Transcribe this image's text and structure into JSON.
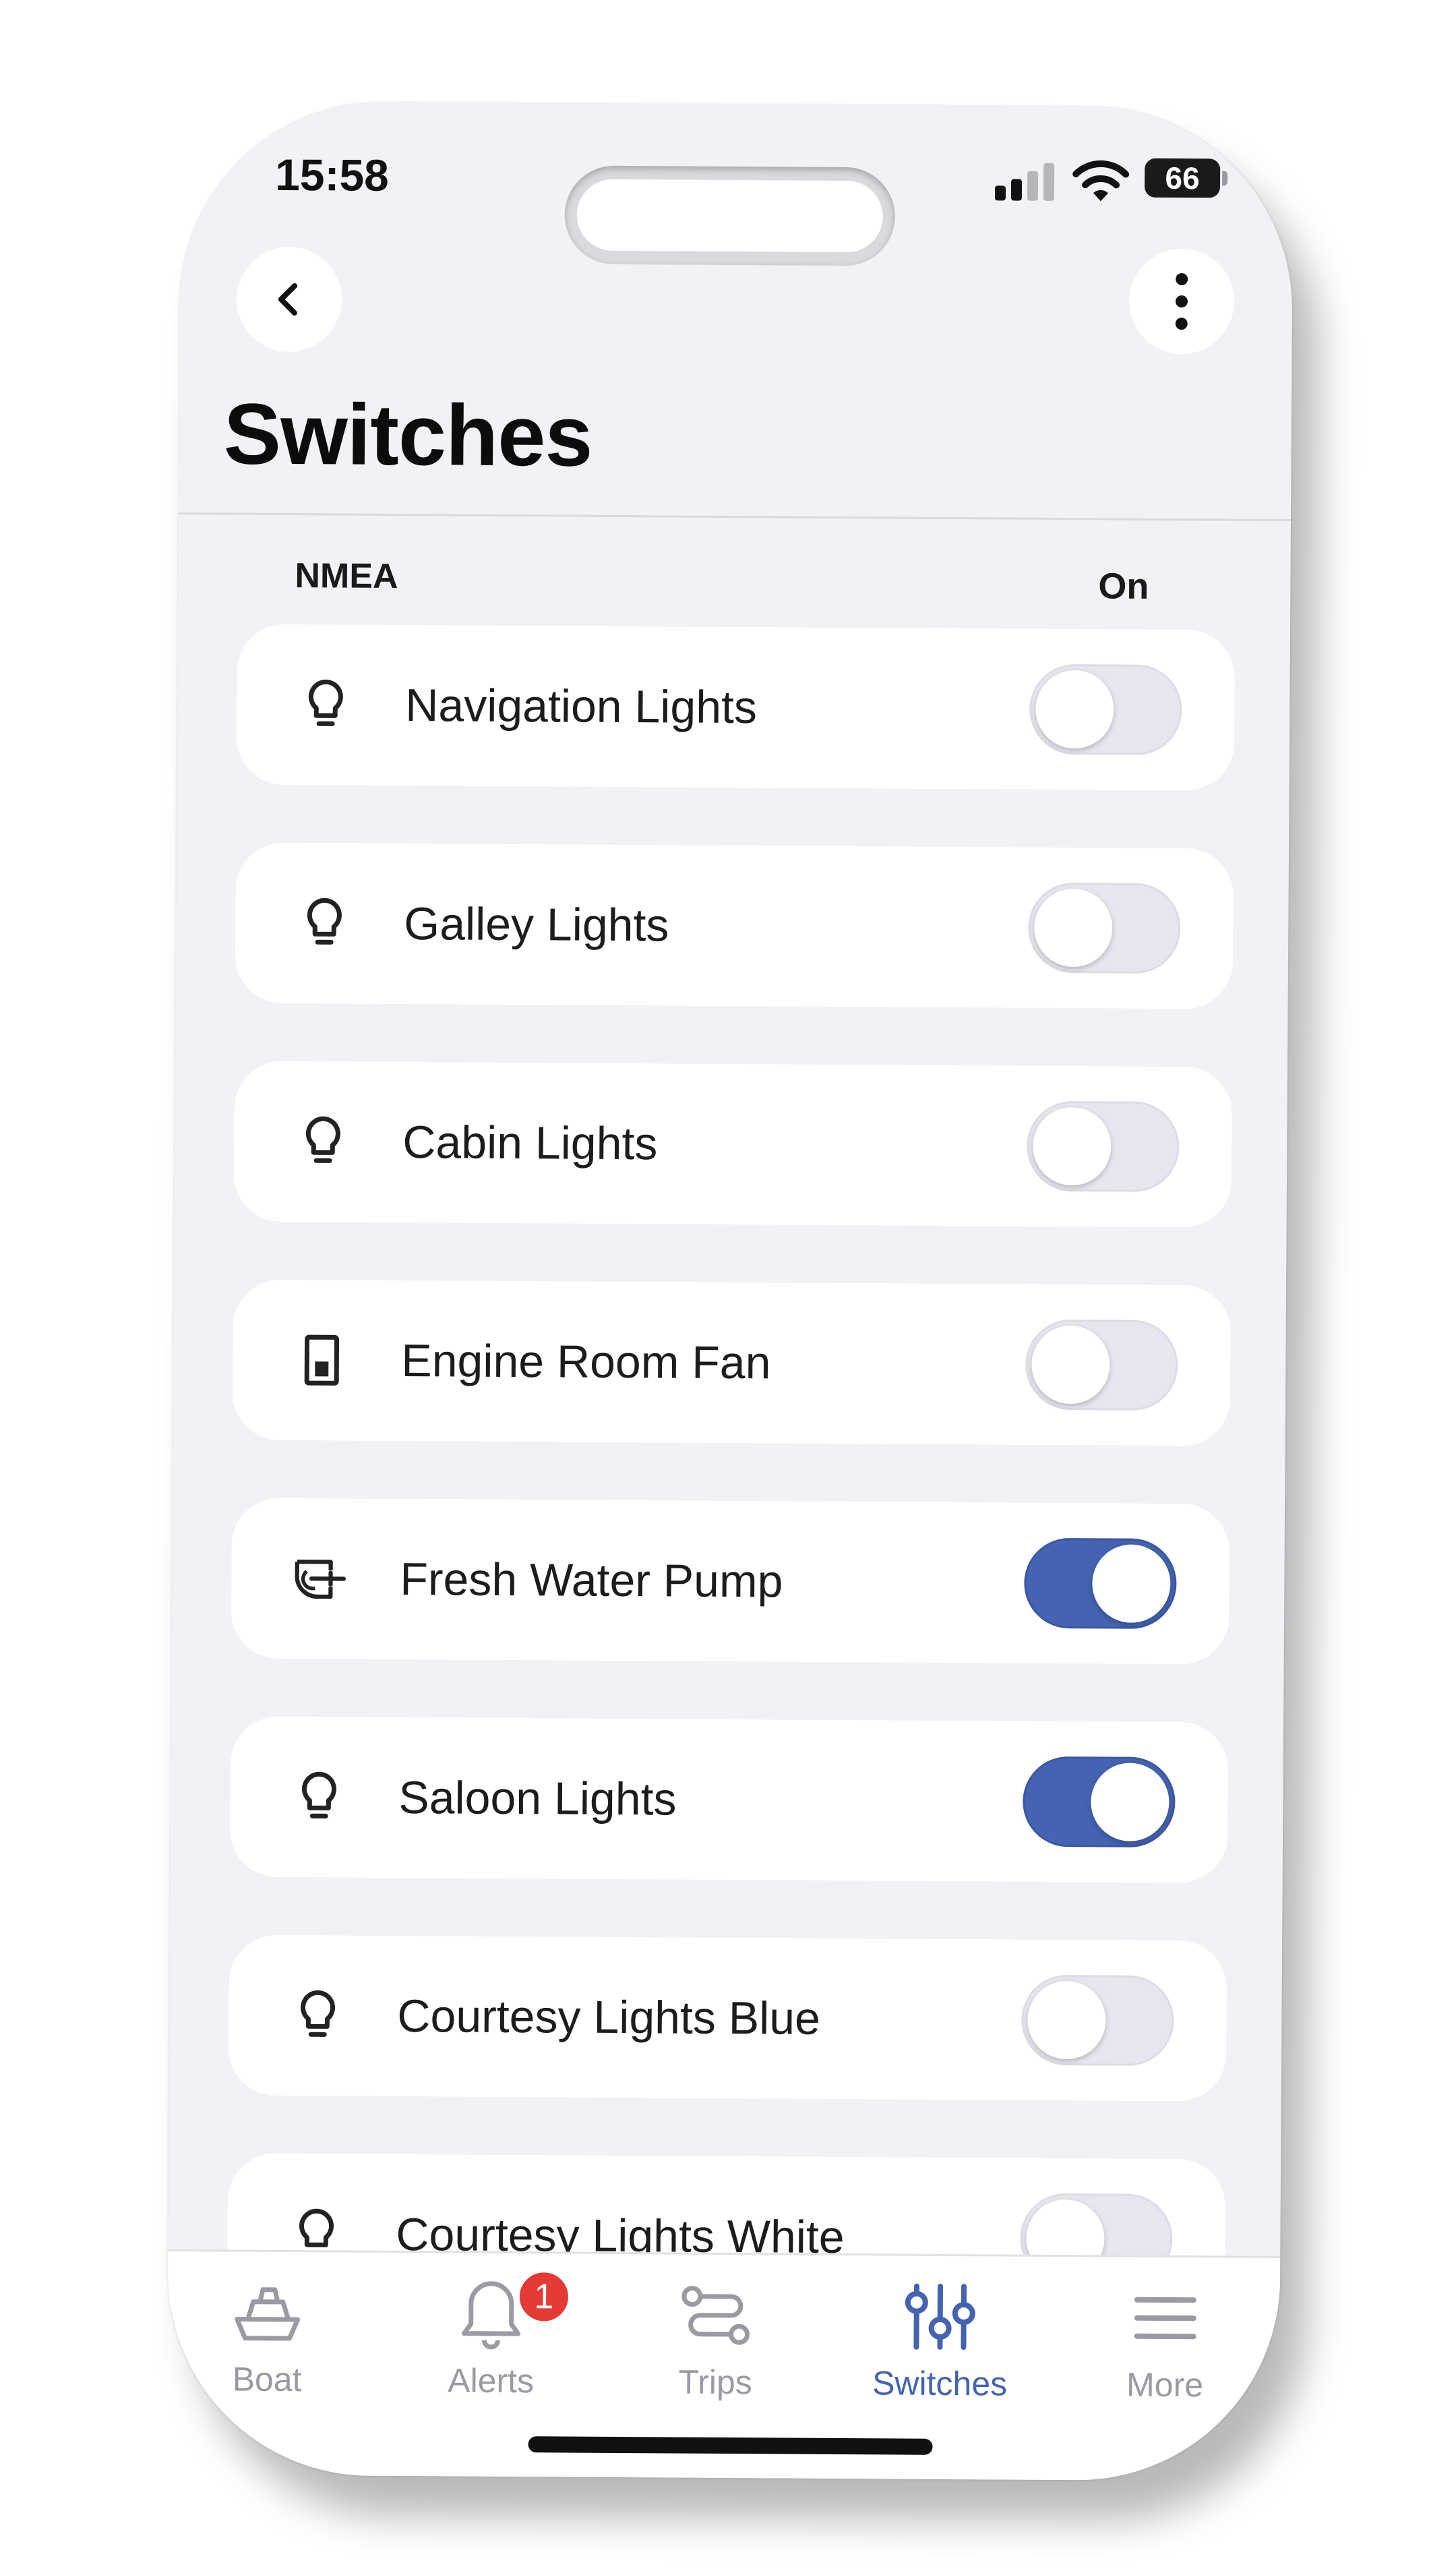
{
  "status_bar": {
    "time": "15:58",
    "battery": "66"
  },
  "header": {
    "title": "Switches"
  },
  "section": {
    "label": "NMEA",
    "column_on": "On"
  },
  "switches": [
    {
      "label": "Navigation Lights",
      "icon": "bulb-icon",
      "on": false
    },
    {
      "label": "Galley Lights",
      "icon": "bulb-icon",
      "on": false
    },
    {
      "label": "Cabin Lights",
      "icon": "bulb-icon",
      "on": false
    },
    {
      "label": "Engine Room Fan",
      "icon": "switch-icon",
      "on": false
    },
    {
      "label": "Fresh Water Pump",
      "icon": "pump-icon",
      "on": true
    },
    {
      "label": "Saloon Lights",
      "icon": "bulb-icon",
      "on": true
    },
    {
      "label": "Courtesy Lights Blue",
      "icon": "bulb-icon",
      "on": false
    },
    {
      "label": "Courtesy Lights White",
      "icon": "bulb-icon",
      "on": false
    }
  ],
  "tabs": [
    {
      "label": "Boat",
      "icon": "boat-icon",
      "active": false
    },
    {
      "label": "Alerts",
      "icon": "bell-icon",
      "active": false,
      "badge": "1"
    },
    {
      "label": "Trips",
      "icon": "route-icon",
      "active": false
    },
    {
      "label": "Switches",
      "icon": "sliders-icon",
      "active": true
    },
    {
      "label": "More",
      "icon": "menu-icon",
      "active": false
    }
  ],
  "colors": {
    "accent": "#4463b0",
    "badge": "#e53935",
    "background": "#f1f1f6"
  }
}
